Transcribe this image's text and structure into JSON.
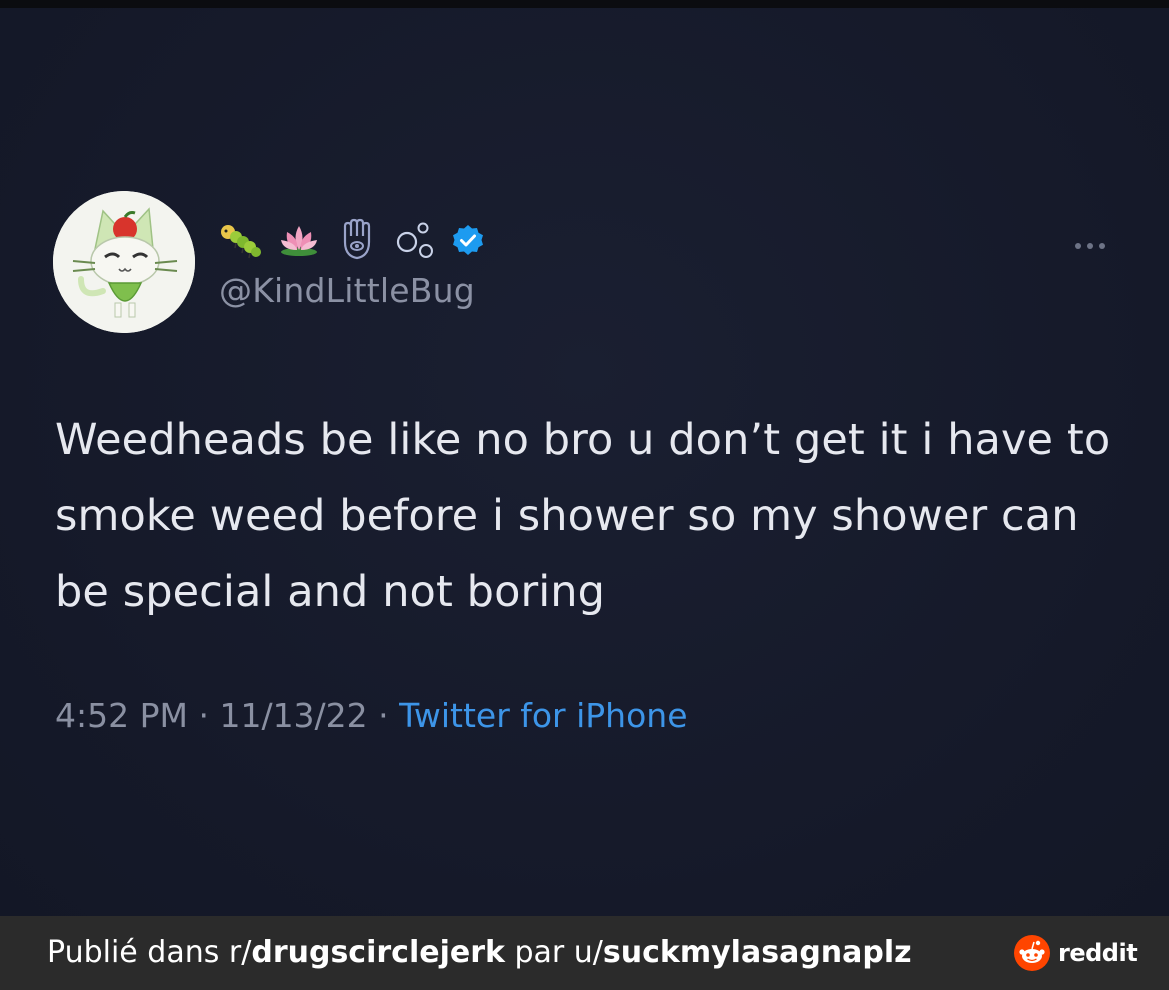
{
  "tweet": {
    "handle": "@KindLittleBug",
    "name_emojis": [
      "caterpillar-icon",
      "lotus-icon",
      "hamsa-icon",
      "bubbles-icon"
    ],
    "verified": true,
    "text": "Weedheads be like no bro u don’t get it i have to smoke weed before i shower so my shower can be special and not boring",
    "time": "4:52 PM",
    "date": "11/13/22",
    "separator": "·",
    "source": "Twitter for iPhone"
  },
  "footer": {
    "prefix": "Publié dans r/",
    "subreddit": "drugscirclejerk",
    "middle": " par u/",
    "username": "suckmylasagnaplz",
    "brand": "reddit"
  },
  "colors": {
    "background": "#161a2a",
    "text": "#e6e8ef",
    "muted": "#8a90a2",
    "link": "#3d95e8",
    "verified": "#1d9bf0",
    "footer_bg": "#2b2b2b",
    "reddit_orange": "#ff4500"
  }
}
